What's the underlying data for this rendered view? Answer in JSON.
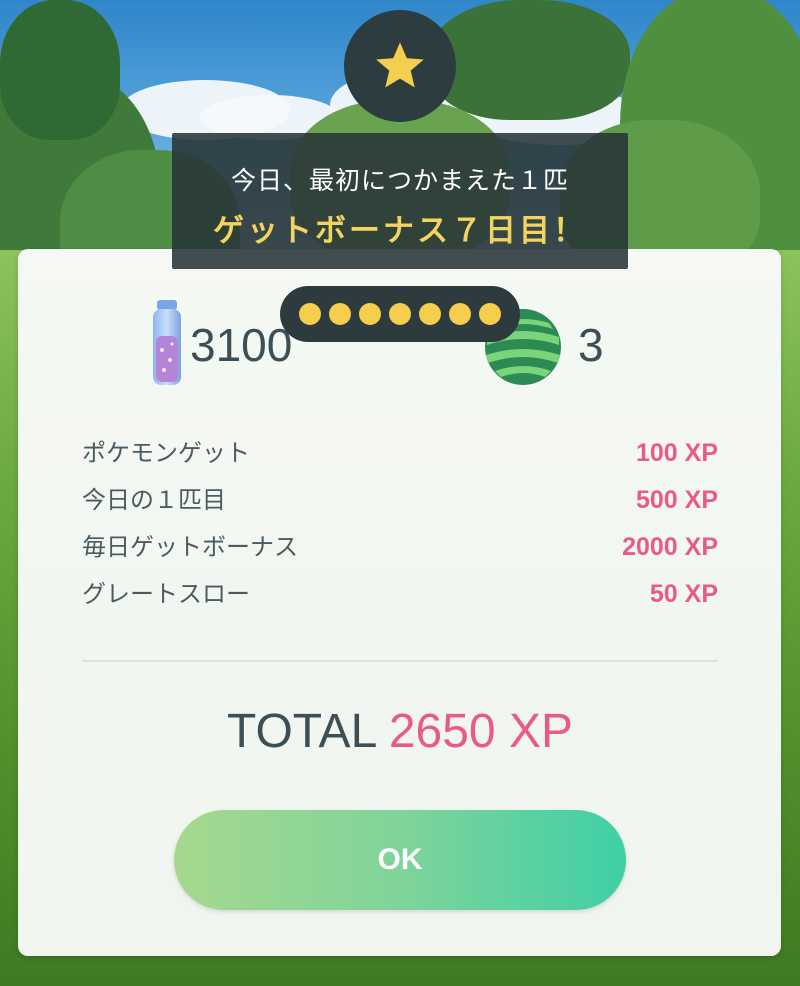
{
  "banner": {
    "line1": "今日、最初につかまえた１匹",
    "line2": "ゲットボーナス７日目！"
  },
  "streak": {
    "count": 7
  },
  "rewards": {
    "stardust": "3100",
    "candy": "3"
  },
  "xp_rows": [
    {
      "label": "ポケモンゲット",
      "value": "100 XP"
    },
    {
      "label": "今日の１匹目",
      "value": "500 XP"
    },
    {
      "label": "毎日ゲットボーナス",
      "value": "2000 XP"
    },
    {
      "label": "グレートスロー",
      "value": "50 XP"
    }
  ],
  "total": {
    "label": "TOTAL",
    "value": "2650 XP"
  },
  "ok_button": {
    "label": "OK"
  },
  "colors": {
    "accent_pink": "#e95b82",
    "gold": "#f4d35e",
    "dark": "#2d3c3f"
  },
  "icons": {
    "badge": "star-icon",
    "stardust": "stardust-icon",
    "candy": "candy-icon"
  }
}
